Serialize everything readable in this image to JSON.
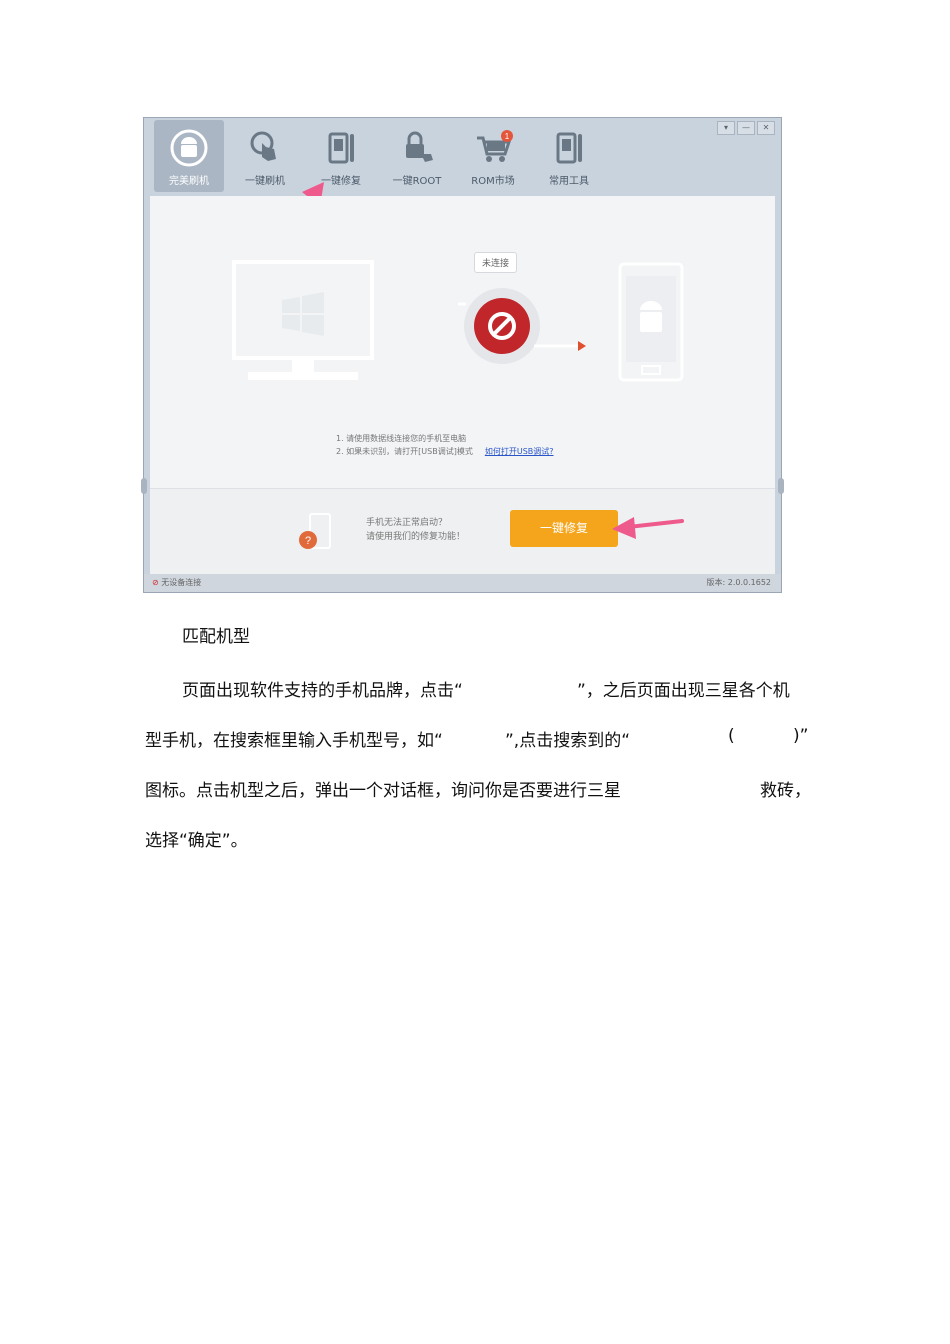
{
  "app": {
    "tabs": [
      {
        "label": "完美刷机",
        "icon": "android-refresh-icon",
        "active": true
      },
      {
        "label": "一键刷机",
        "icon": "hand-touch-icon",
        "active": false
      },
      {
        "label": "一键修复",
        "icon": "phone-wrench-icon",
        "active": false
      },
      {
        "label": "一键ROOT",
        "icon": "lock-hand-icon",
        "active": false
      },
      {
        "label": "ROM市场",
        "icon": "cart-icon",
        "active": false
      },
      {
        "label": "常用工具",
        "icon": "tools-icon",
        "active": false
      }
    ],
    "cart_badge": "1",
    "window_controls": [
      "▾",
      "—",
      "✕"
    ],
    "connection_status": "未连接",
    "notes": {
      "line1": "1. 请使用数据线连接您的手机至电脑",
      "line2": "2. 如果未识别，请打开[USB调试]模式",
      "link": "如何打开USB调试?"
    },
    "bottom": {
      "line1": "手机无法正常启动？",
      "line2": "请使用我们的修复功能！",
      "button": "一键修复"
    },
    "statusbar": {
      "left": "无设备连接",
      "right": "版本: 2.0.0.1652"
    }
  },
  "doc": {
    "heading": "匹配机型",
    "p1_a": "页面出现软件支持的手机品牌，点击“",
    "p1_b": "”，之后页面出现三星各个机",
    "p2_a": "型手机，在搜索框里输入手机型号，如“",
    "p2_b": "”,点击搜索到的“",
    "p2_c": "(",
    "p2_d": ")”",
    "p3_a": "图标。点击机型之后，弹出一个对话框，询问你是否要进行三星",
    "p3_b": "救砖，",
    "p4": "选择“确定”。"
  }
}
